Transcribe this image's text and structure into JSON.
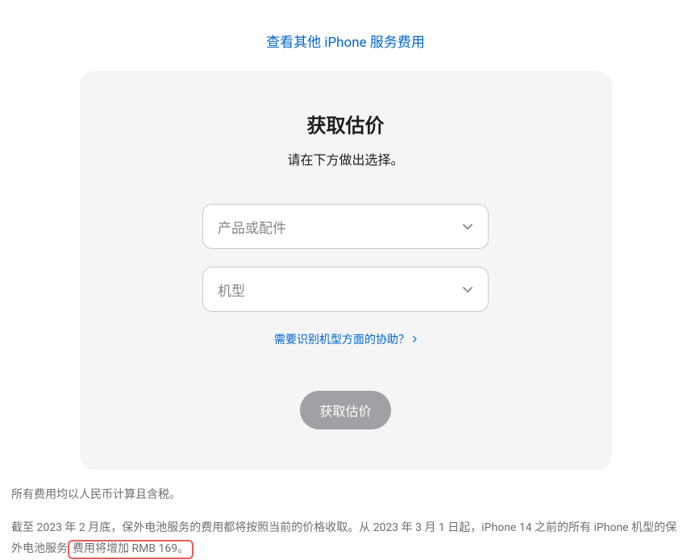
{
  "topLink": "查看其他 iPhone 服务费用",
  "card": {
    "title": "获取估价",
    "subtitle": "请在下方做出选择。",
    "select1": {
      "placeholder": "产品或配件"
    },
    "select2": {
      "placeholder": "机型"
    },
    "helpLink": "需要识别机型方面的协助？",
    "submitButton": "获取估价"
  },
  "footer": {
    "para1": "所有费用均以人民币计算且含税。",
    "para2_part1": "截至 2023 年 2 月底，保外电池服务的费用都将按照当前的价格收取。从 2023 年 3 月 1 日起，iPhone 14 之前的所有 iPhone 机型的保外电池服务",
    "para2_highlight": "费用将增加 RMB 169。"
  }
}
